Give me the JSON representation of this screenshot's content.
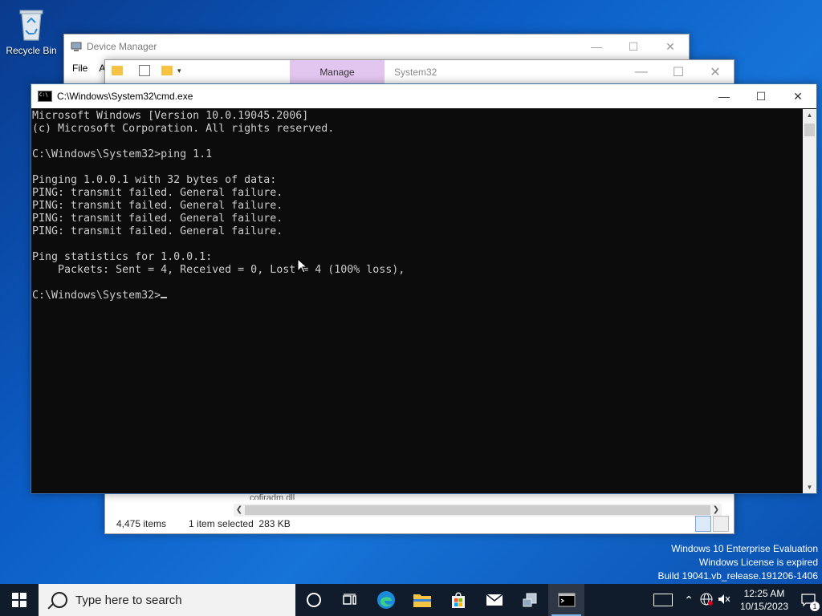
{
  "desktop": {
    "recycle_bin_label": "Recycle Bin"
  },
  "device_manager": {
    "title": "Device Manager",
    "menu_file": "File",
    "menu_action": "A"
  },
  "explorer": {
    "manage_tab": "Manage",
    "path_label": "System32",
    "status_items": "4,475 items",
    "status_selected": "1 item selected  283 KB",
    "partial_row": "cofiradm.dll"
  },
  "cmd": {
    "title": "C:\\Windows\\System32\\cmd.exe",
    "lines": [
      "Microsoft Windows [Version 10.0.19045.2006]",
      "(c) Microsoft Corporation. All rights reserved.",
      "",
      "C:\\Windows\\System32>ping 1.1",
      "",
      "Pinging 1.0.0.1 with 32 bytes of data:",
      "PING: transmit failed. General failure.",
      "PING: transmit failed. General failure.",
      "PING: transmit failed. General failure.",
      "PING: transmit failed. General failure.",
      "",
      "Ping statistics for 1.0.0.1:",
      "    Packets: Sent = 4, Received = 0, Lost = 4 (100% loss),",
      ""
    ],
    "prompt": "C:\\Windows\\System32>"
  },
  "watermark": {
    "line1": "Windows 10 Enterprise Evaluation",
    "line2": "Windows License is expired",
    "line3": "Build 19041.vb_release.191206-1406"
  },
  "taskbar": {
    "search_placeholder": "Type here to search",
    "time": "12:25 AM",
    "date": "10/15/2023",
    "notification_count": "1"
  }
}
